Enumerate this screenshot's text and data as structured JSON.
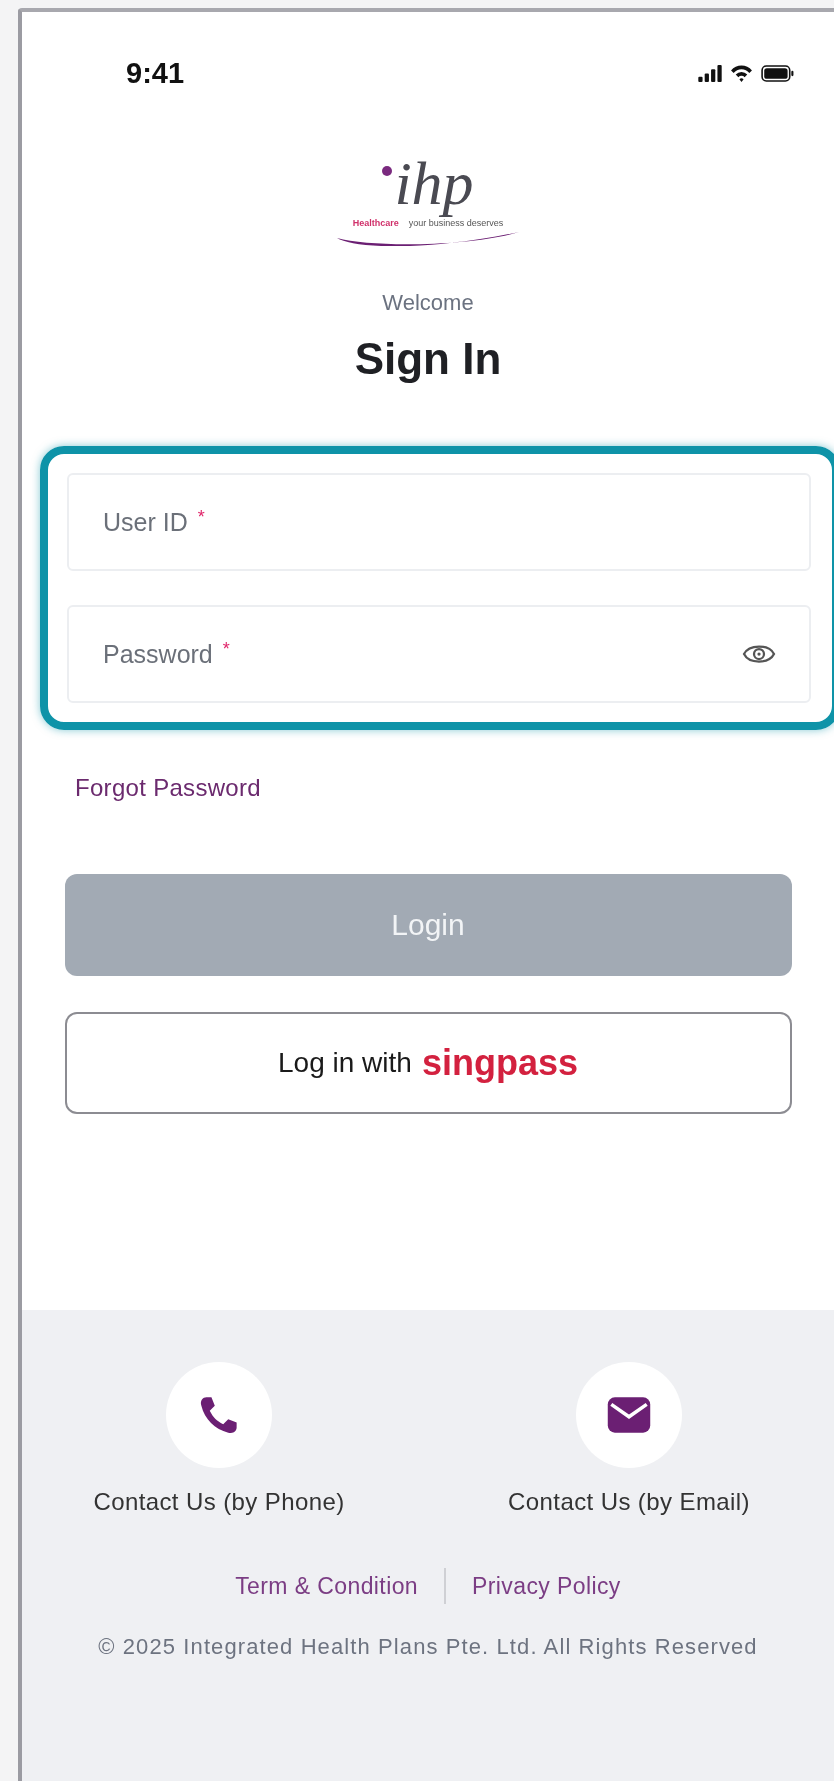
{
  "status_bar": {
    "time": "9:41"
  },
  "logo": {
    "wordmark": "ihp",
    "tagline_left": "Healthcare",
    "tagline_right": "your business deserves"
  },
  "welcome": "Welcome",
  "title": "Sign In",
  "login_form": {
    "highlighted": true,
    "fields": [
      {
        "kind": "text",
        "placeholder": "User ID",
        "required_mark": "*"
      },
      {
        "kind": "password",
        "placeholder": "Password",
        "required_mark": "*"
      }
    ]
  },
  "forgot_password": "Forgot Password",
  "buttons": [
    {
      "kind": "primary",
      "label": "Login",
      "disabled": true
    },
    {
      "kind": "singpass",
      "label": "Log in with",
      "brand": "singpass",
      "disabled": false
    }
  ],
  "contacts": [
    {
      "kind": "phone",
      "label": "Contact Us (by Phone)"
    },
    {
      "kind": "email",
      "label": "Contact Us (by Email)"
    }
  ],
  "legal_links": [
    "Term & Condition",
    "Privacy Policy"
  ],
  "copyright": "© 2025 Integrated Health Plans Pte. Ltd. All Rights Reserved"
}
